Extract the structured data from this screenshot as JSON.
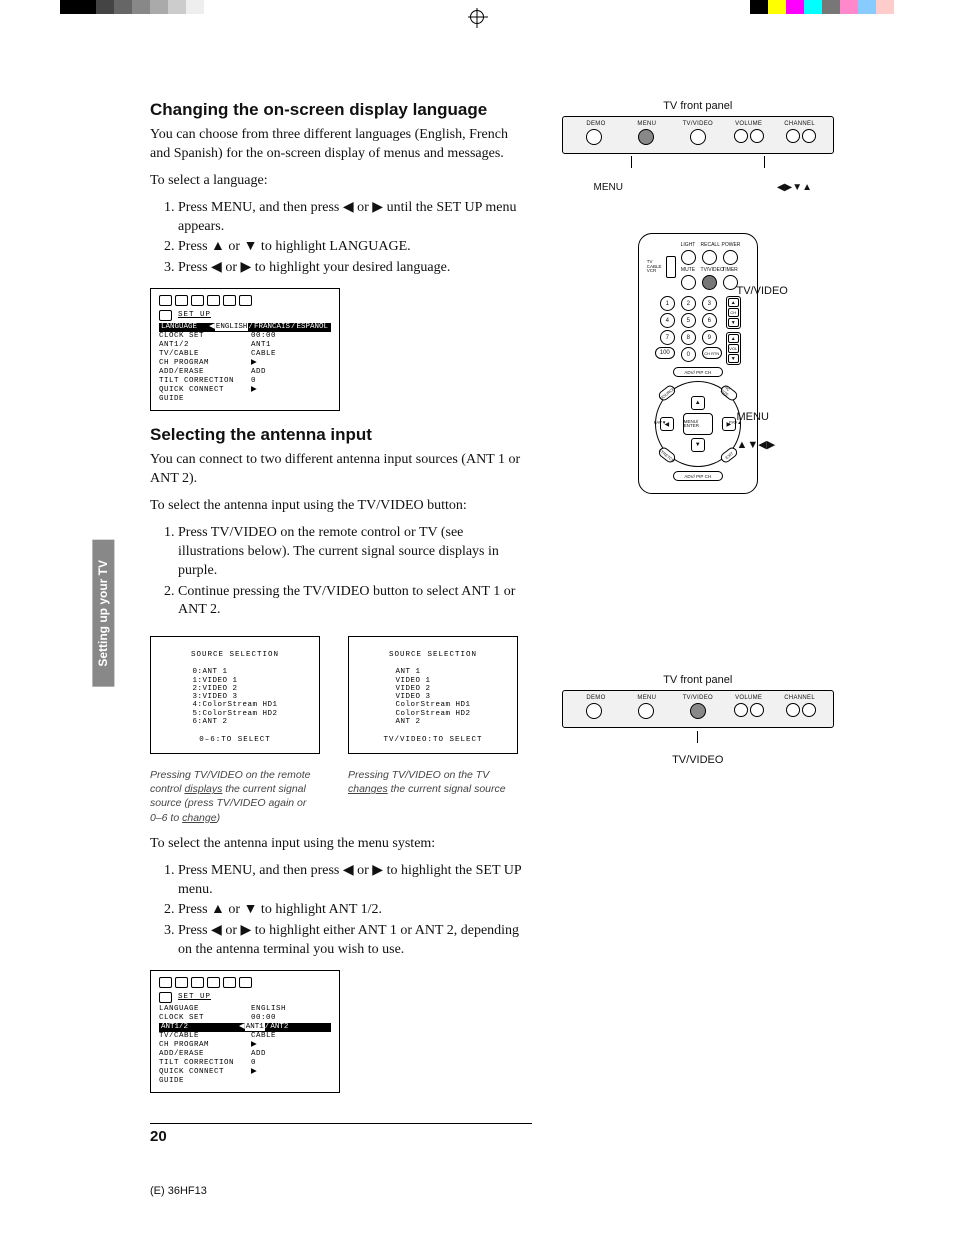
{
  "section_tab": "Setting up\nyour TV",
  "page_number": "20",
  "footer_code": "(E) 36HF13",
  "lang_section": {
    "heading": "Changing the on-screen display language",
    "intro": "You can choose from three different languages (English, French and Spanish) for the on-screen display of menus and messages.",
    "lead": "To select a language:",
    "steps": [
      "Press MENU, and then press ◀ or ▶ until the SET UP menu appears.",
      "Press ▲ or ▼ to highlight LANGUAGE.",
      "Press ◀ or ▶ to highlight your desired language."
    ]
  },
  "antenna_section": {
    "heading": "Selecting the antenna input",
    "intro": "You can connect to two different antenna input sources (ANT 1 or ANT 2).",
    "lead_tvbtn": "To select the antenna input using the TV/VIDEO button:",
    "steps_tvbtn": [
      "Press TV/VIDEO on the remote control or TV (see illustrations below). The current signal source displays in purple.",
      "Continue pressing the TV/VIDEO button to select ANT 1 or ANT 2."
    ],
    "lead_menu": "To select the antenna input using the menu system:",
    "steps_menu": [
      "Press MENU, and then press ◀ or ▶ to highlight the SET UP menu.",
      "Press ▲ or ▼ to highlight ANT 1/2.",
      "Press ◀ or ▶ to highlight either ANT 1 or ANT 2, depending on the antenna terminal you wish to use."
    ]
  },
  "osd1": {
    "title": "SET UP",
    "highlight": {
      "label": "LANGUAGE",
      "options": [
        "ENGLISH",
        "FRANCAIS",
        "ESPANOL"
      ],
      "selected": "ENGLISH"
    },
    "rows": [
      {
        "label": "CLOCK SET",
        "val": "00:00"
      },
      {
        "label": "ANT1/2",
        "val": "ANT1"
      },
      {
        "label": "TV/CABLE",
        "val": "CABLE"
      },
      {
        "label": "CH PROGRAM",
        "val": "▶"
      },
      {
        "label": "ADD/ERASE",
        "val": "ADD"
      },
      {
        "label": "TILT CORRECTION",
        "val": "0"
      },
      {
        "label": "QUICK CONNECT GUIDE",
        "val": "▶"
      }
    ]
  },
  "osd2": {
    "title": "SET UP",
    "rows_pre": [
      {
        "label": "LANGUAGE",
        "val": "ENGLISH"
      },
      {
        "label": "CLOCK SET",
        "val": "00:00"
      }
    ],
    "highlight": {
      "label": "ANT1/2",
      "options": [
        "ANT1",
        "ANT2"
      ],
      "selected": "ANT1"
    },
    "rows_post": [
      {
        "label": "TV/CABLE",
        "val": "CABLE"
      },
      {
        "label": "CH PROGRAM",
        "val": "▶"
      },
      {
        "label": "ADD/ERASE",
        "val": "ADD"
      },
      {
        "label": "TILT CORRECTION",
        "val": "0"
      },
      {
        "label": "QUICK CONNECT GUIDE",
        "val": "▶"
      }
    ]
  },
  "src_left": {
    "header": "SOURCE SELECTION",
    "items": [
      "0:ANT 1",
      "1:VIDEO 1",
      "2:VIDEO 2",
      "3:VIDEO 3",
      "4:ColorStream HD1",
      "5:ColorStream HD2",
      "6:ANT 2"
    ],
    "footer": "0–6:TO SELECT",
    "caption": "Pressing TV/VIDEO on the remote control displays the current signal source (press TV/VIDEO again or 0–6 to change)",
    "caption_u1": "displays",
    "caption_u2": "change"
  },
  "src_right": {
    "header": "SOURCE SELECTION",
    "items": [
      "ANT 1",
      "VIDEO 1",
      "VIDEO 2",
      "VIDEO 3",
      "ColorStream HD1",
      "ColorStream HD2",
      "ANT 2"
    ],
    "footer": "TV/VIDEO:TO SELECT",
    "caption": "Pressing TV/VIDEO on the TV changes the current signal source",
    "caption_u1": "changes"
  },
  "panel1": {
    "title": "TV front panel",
    "labels": [
      "DEMO",
      "MENU",
      "TV/VIDEO",
      "VOLUME",
      "CHANNEL"
    ],
    "callout_left": "MENU",
    "callout_right": "◀▶▼▲"
  },
  "panel2": {
    "title": "TV front panel",
    "labels": [
      "DEMO",
      "MENU",
      "TV/VIDEO",
      "VOLUME",
      "CHANNEL"
    ],
    "callout": "TV/VIDEO"
  },
  "remote": {
    "top_labels": [
      "LIGHT",
      "RECALL",
      "POWER"
    ],
    "switch_labels": [
      "TV",
      "CABLE",
      "VCR"
    ],
    "mid_labels": [
      "MUTE",
      "TV/VIDEO",
      "TIMER"
    ],
    "numbers": [
      "1",
      "2",
      "3",
      "4",
      "5",
      "6",
      "7",
      "8",
      "9",
      "100",
      "0"
    ],
    "chrtn": "CH RTN",
    "ch": "CH",
    "vol": "VOL",
    "pill_top": "ADV/\nPIP CH",
    "pill_bottom": "ADV/\nPIP CH",
    "diag": [
      "SOURCE",
      "PIC SIZE",
      "STRETCH",
      "EXIT"
    ],
    "center": "MENU/\nENTER",
    "fav_l": "FAV▼",
    "fav_r": "FAV▲",
    "callouts": [
      "TV/VIDEO",
      "MENU",
      "▲▼◀▶"
    ]
  }
}
